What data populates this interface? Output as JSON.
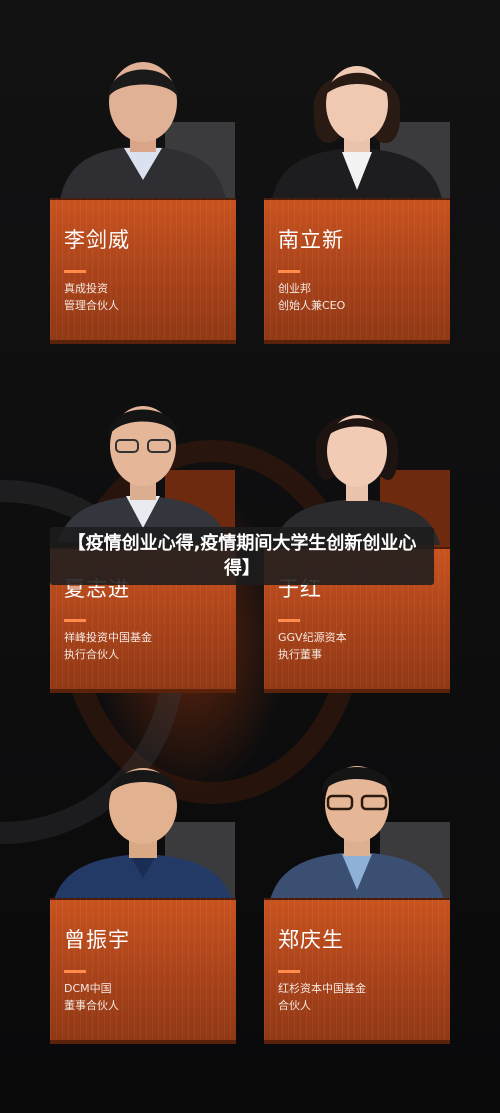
{
  "banner": {
    "title": "【疫情创业心得,疫情期间大学生创新创业心得】"
  },
  "people": [
    {
      "name": "李剑威",
      "line1": "真成投资",
      "line2": "管理合伙人"
    },
    {
      "name": "南立新",
      "line1": "创业邦",
      "line2": "创始人兼CEO"
    },
    {
      "name": "夏志进",
      "line1": "祥峰投资中国基金",
      "line2": "执行合伙人"
    },
    {
      "name": "于红",
      "line1": "GGV纪源资本",
      "line2": "执行董事"
    },
    {
      "name": "曾振宇",
      "line1": "DCM中国",
      "line2": "董事合伙人"
    },
    {
      "name": "郑庆生",
      "line1": "红杉资本中国基金",
      "line2": "合伙人"
    }
  ],
  "colors": {
    "card": "#c9531f",
    "accent": "#ff8a4a",
    "background": "#0b0b0c"
  }
}
